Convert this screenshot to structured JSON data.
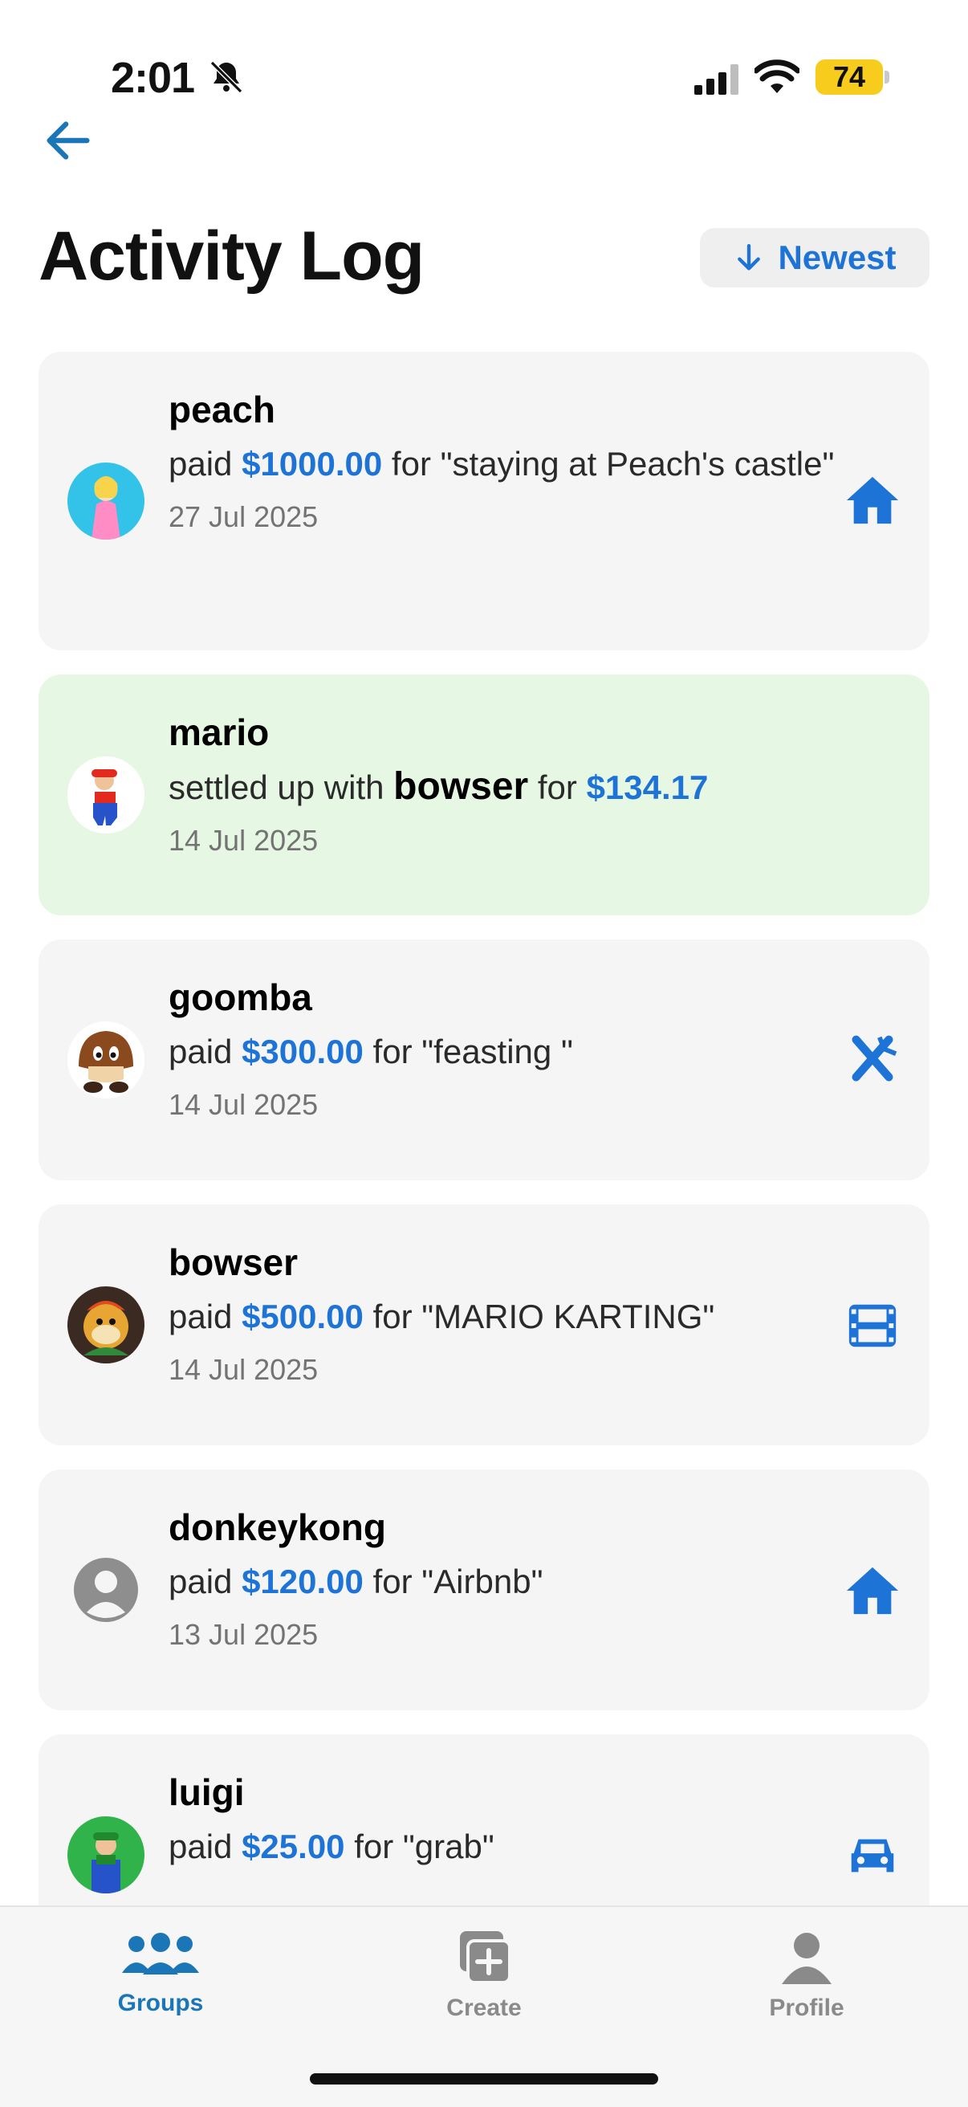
{
  "status_bar": {
    "time": "2:01",
    "battery": "74"
  },
  "header": {
    "title": "Activity Log",
    "sort_label": "Newest"
  },
  "activities": [
    {
      "user": "peach",
      "prefix": "paid ",
      "amount": "$1000.00",
      "suffix": " for \"staying at Peach's castle\"",
      "date": "27 Jul 2025",
      "category_icon": "house-icon"
    },
    {
      "user": "mario",
      "prefix": "settled up with ",
      "other": "bowser",
      "middle": " for ",
      "amount": "$134.17",
      "date": "14 Jul 2025",
      "settled": true
    },
    {
      "user": "goomba",
      "prefix": "paid ",
      "amount": "$300.00",
      "suffix": " for \"feasting \"",
      "date": "14 Jul 2025",
      "category_icon": "utensils-icon"
    },
    {
      "user": "bowser",
      "prefix": "paid ",
      "amount": "$500.00",
      "suffix": " for \"MARIO KARTING\"",
      "date": "14 Jul 2025",
      "category_icon": "film-icon"
    },
    {
      "user": "donkeykong",
      "prefix": "paid ",
      "amount": "$120.00",
      "suffix": " for \"Airbnb\"",
      "date": "13 Jul 2025",
      "category_icon": "house-icon"
    },
    {
      "user": "luigi",
      "prefix": "paid ",
      "amount": "$25.00",
      "suffix": " for \"grab\"",
      "category_icon": "car-icon"
    }
  ],
  "tabs": [
    {
      "label": "Groups",
      "active": true,
      "icon": "people-icon"
    },
    {
      "label": "Create",
      "active": false,
      "icon": "add-icon"
    },
    {
      "label": "Profile",
      "active": false,
      "icon": "person-icon"
    }
  ],
  "colors": {
    "accent": "#1d74d6",
    "settled_bg": "#e6f8e4",
    "card_bg": "#f5f5f5",
    "tab_active": "#1a76b6"
  }
}
